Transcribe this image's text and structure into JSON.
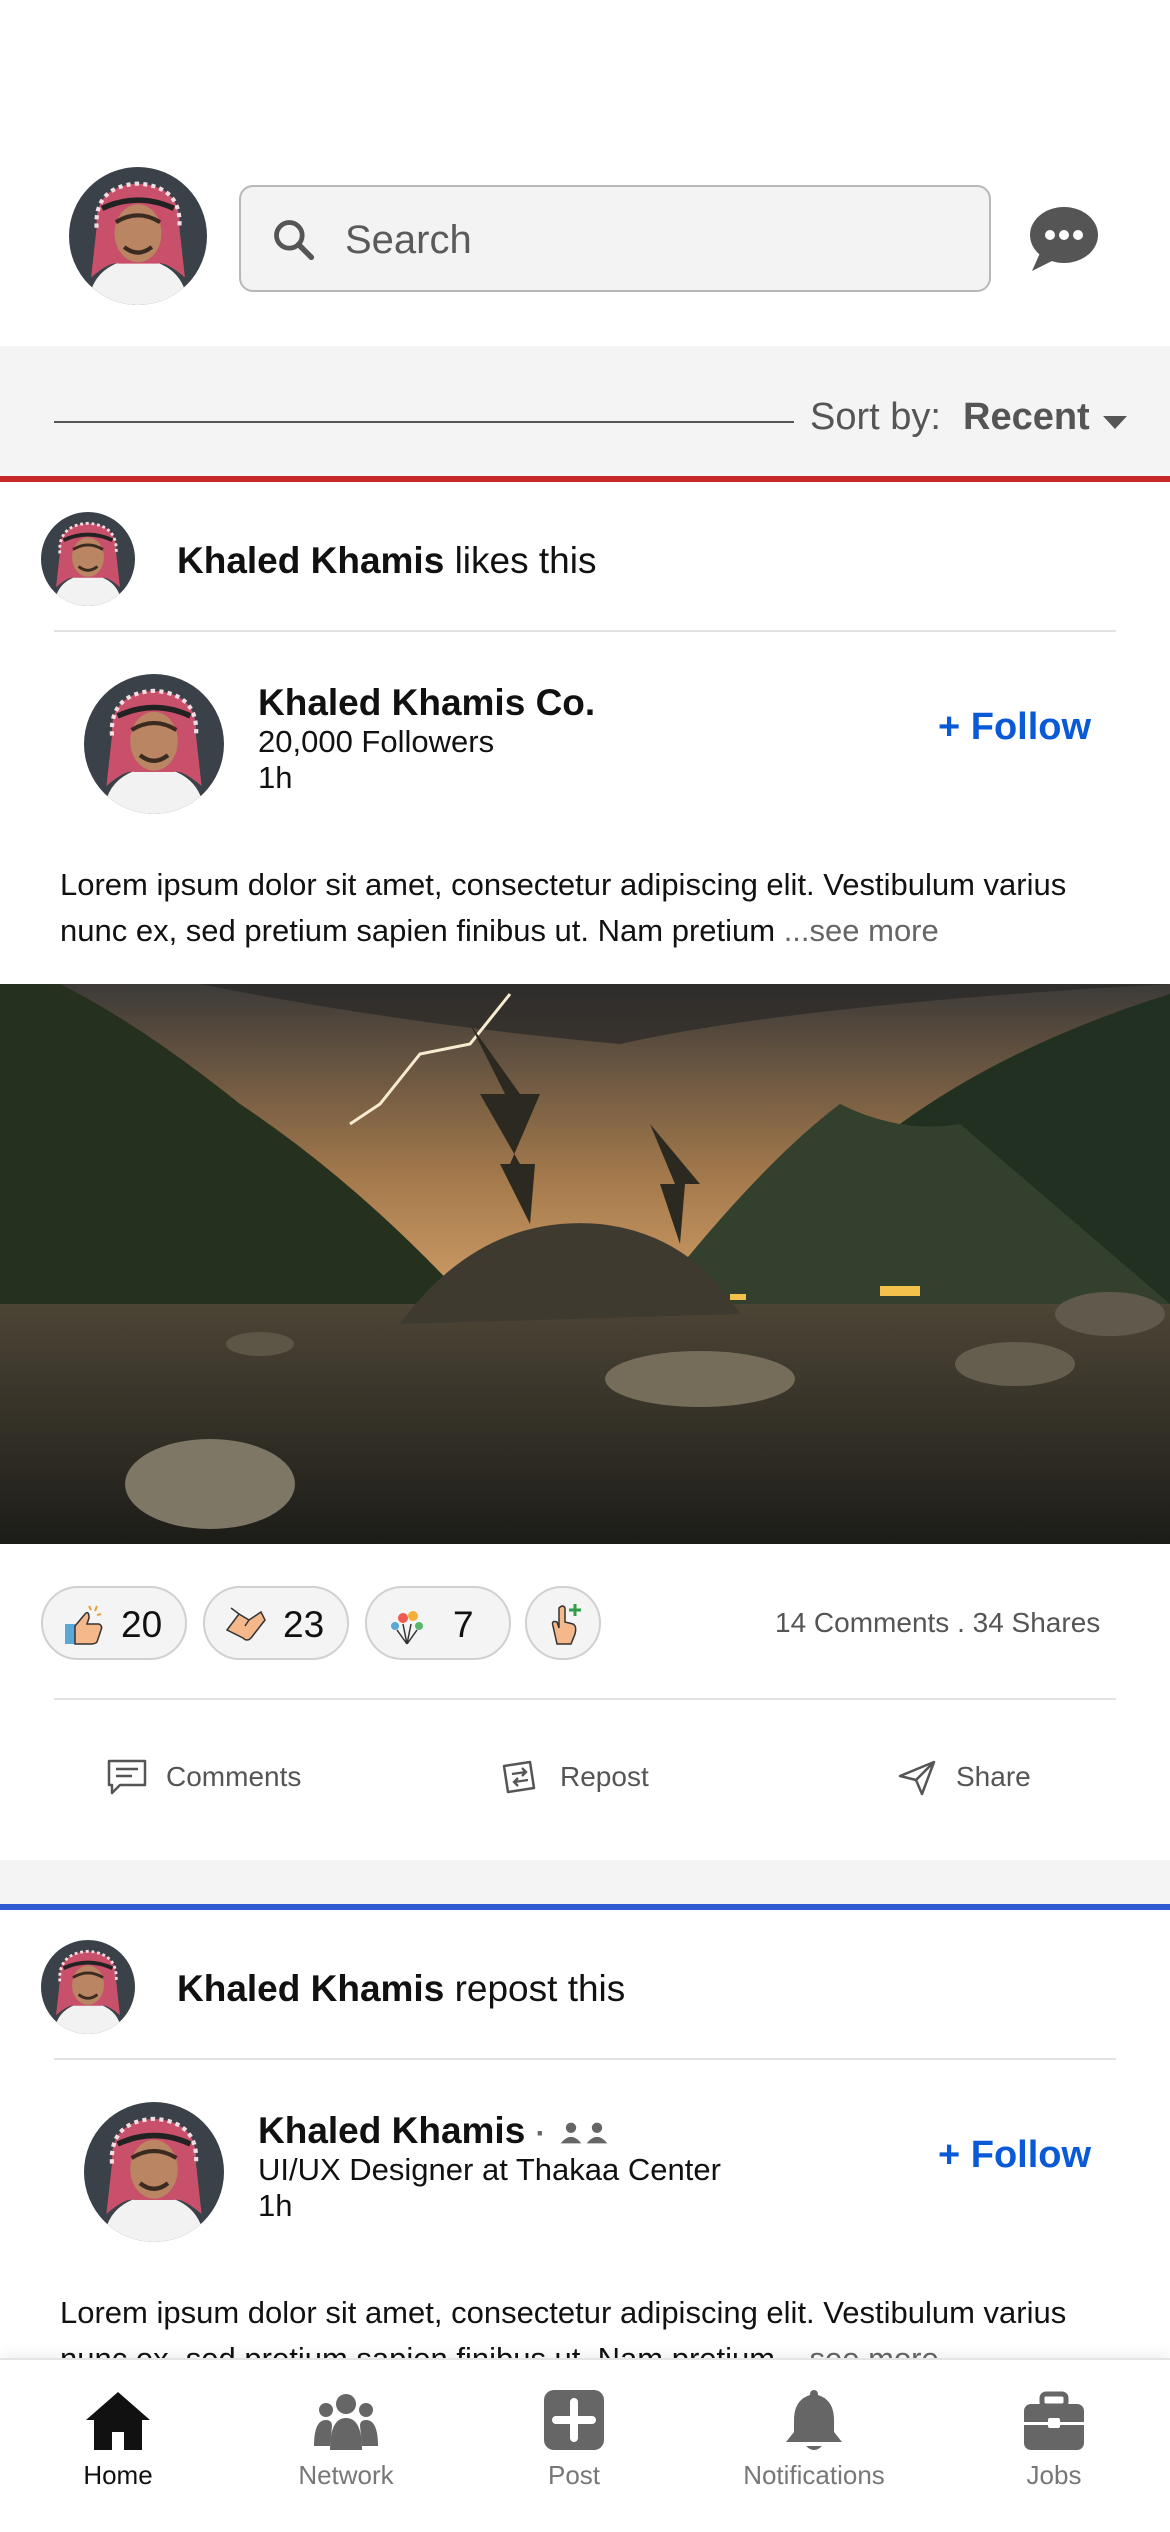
{
  "header": {
    "search_placeholder": "Search",
    "icons": {
      "search": "search-icon",
      "messages": "messages-icon"
    }
  },
  "sort": {
    "label": "Sort by:",
    "value": "Recent"
  },
  "posts": [
    {
      "accent": "#c62828",
      "activity_user": "Khaled Khamis",
      "activity_action": " likes this",
      "author": "Khaled Khamis Co.",
      "author_line": "20,000 Followers",
      "time": "1h",
      "follow_label": "+ Follow",
      "text": "Lorem ipsum dolor sit amet, consectetur adipiscing elit. Vestibulum varius nunc ex, sed pretium sapien finibus ut. Nam pretium ",
      "see_more": "...see more",
      "reactions": [
        {
          "icon": "clapping-thumbs-up-icon",
          "count": "20"
        },
        {
          "icon": "handshake-icon",
          "count": "23"
        },
        {
          "icon": "celebrate-icon",
          "count": "7"
        },
        {
          "icon": "add-reaction-icon",
          "count": ""
        }
      ],
      "stats": "14 Comments . 34 Shares",
      "actions": {
        "comments": "Comments",
        "repost": "Repost",
        "share": "Share"
      }
    },
    {
      "accent": "#2e5bd3",
      "activity_user": "Khaled Khamis",
      "activity_action": " repost this",
      "author": "Khaled Khamis",
      "author_badge": "·",
      "author_line": "UI/UX Designer at Thakaa Center",
      "time": "1h",
      "follow_label": "+ Follow",
      "text": "Lorem ipsum dolor sit amet, consectetur adipiscing elit. Vestibulum varius nunc ex, sed pretium sapien finibus ut. Nam pretium ",
      "see_more": "...see more"
    }
  ],
  "nav": {
    "active_color": "#111111",
    "items": [
      {
        "label": "Home",
        "icon": "home-icon"
      },
      {
        "label": "Network",
        "icon": "network-icon"
      },
      {
        "label": "Post",
        "icon": "post-icon"
      },
      {
        "label": "Notifications",
        "icon": "bell-icon"
      },
      {
        "label": "Jobs",
        "icon": "briefcase-icon"
      }
    ]
  }
}
